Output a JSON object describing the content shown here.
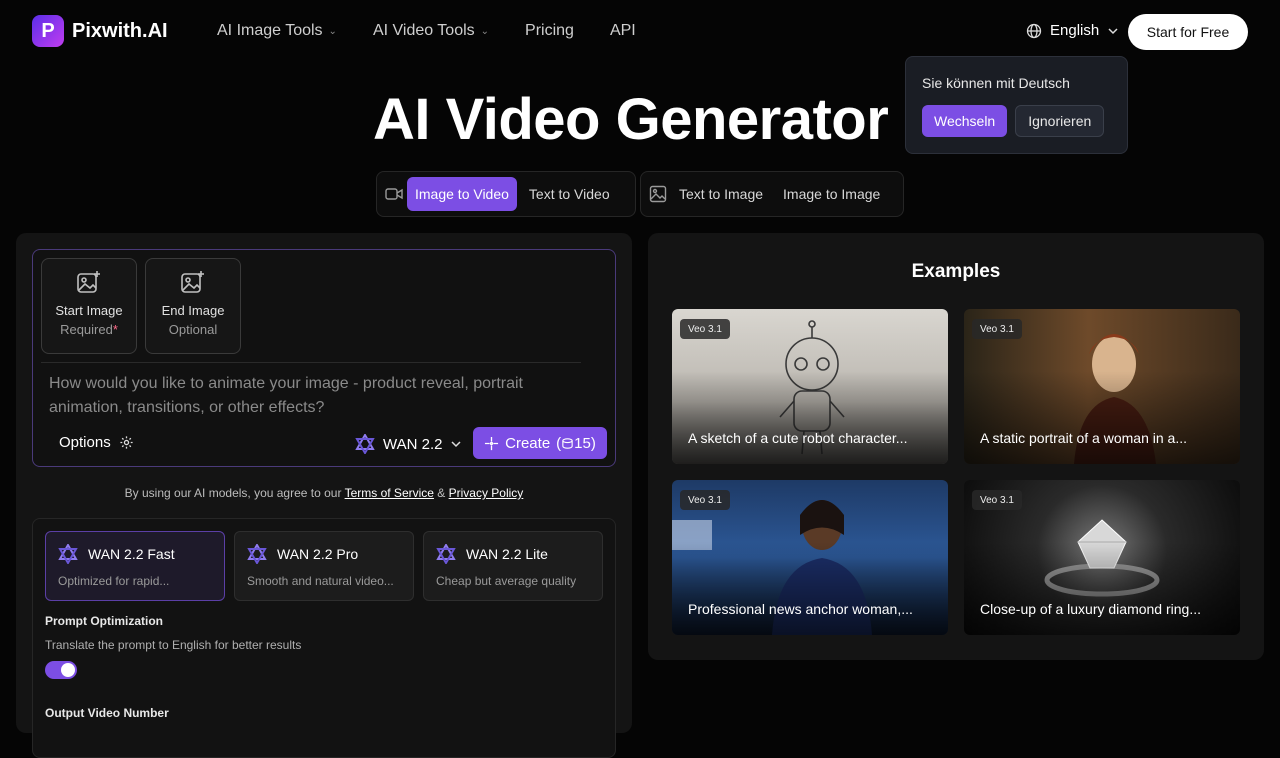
{
  "brand": {
    "name": "Pixwith.AI",
    "logo_letter": "P"
  },
  "nav": {
    "links": [
      {
        "label": "AI Image Tools",
        "dropdown": true
      },
      {
        "label": "AI Video Tools",
        "dropdown": true
      },
      {
        "label": "Pricing",
        "dropdown": false
      },
      {
        "label": "API",
        "dropdown": false
      }
    ],
    "language": "English",
    "cta": "Start for Free"
  },
  "lang_popup": {
    "message": "Sie können mit Deutsch",
    "switch_label": "Wechseln",
    "ignore_label": "Ignorieren"
  },
  "hero": {
    "title": "AI Video Generator"
  },
  "modes": {
    "video": [
      "Image to Video",
      "Text to Video"
    ],
    "image": [
      "Text to Image",
      "Image to Image"
    ],
    "active": "Image to Video"
  },
  "uploader": {
    "start": {
      "title": "Start Image",
      "sub": "Required",
      "required_mark": "*"
    },
    "end": {
      "title": "End Image",
      "sub": "Optional"
    }
  },
  "prompt": {
    "placeholder": "How would you like to animate your image - product reveal, portrait animation, transitions, or other effects?"
  },
  "controls": {
    "options_label": "Options",
    "model_label": "WAN 2.2",
    "create_label": "Create",
    "credits": "15"
  },
  "terms": {
    "prefix": "By using our AI models, you agree to our ",
    "tos": "Terms of Service",
    "amp": " & ",
    "privacy": "Privacy Policy"
  },
  "models": [
    {
      "name": "WAN 2.2 Fast",
      "desc": "Optimized for rapid...",
      "active": true
    },
    {
      "name": "WAN 2.2 Pro",
      "desc": "Smooth and natural video...",
      "active": false
    },
    {
      "name": "WAN 2.2 Lite",
      "desc": "Cheap but average quality",
      "active": false
    }
  ],
  "prompt_opt": {
    "title": "Prompt Optimization",
    "desc": "Translate the prompt to English for better results",
    "enabled": true
  },
  "output": {
    "title": "Output Video Number"
  },
  "examples": {
    "title": "Examples",
    "items": [
      {
        "badge": "Veo 3.1",
        "caption": "A sketch of a cute robot character..."
      },
      {
        "badge": "Veo 3.1",
        "caption": "A static portrait of a woman in a..."
      },
      {
        "badge": "Veo 3.1",
        "caption": "Professional news anchor woman,..."
      },
      {
        "badge": "Veo 3.1",
        "caption": "Close-up of a luxury diamond ring..."
      }
    ]
  },
  "colors": {
    "accent": "#7c4ee4",
    "background": "#050505",
    "panel": "#141414"
  }
}
